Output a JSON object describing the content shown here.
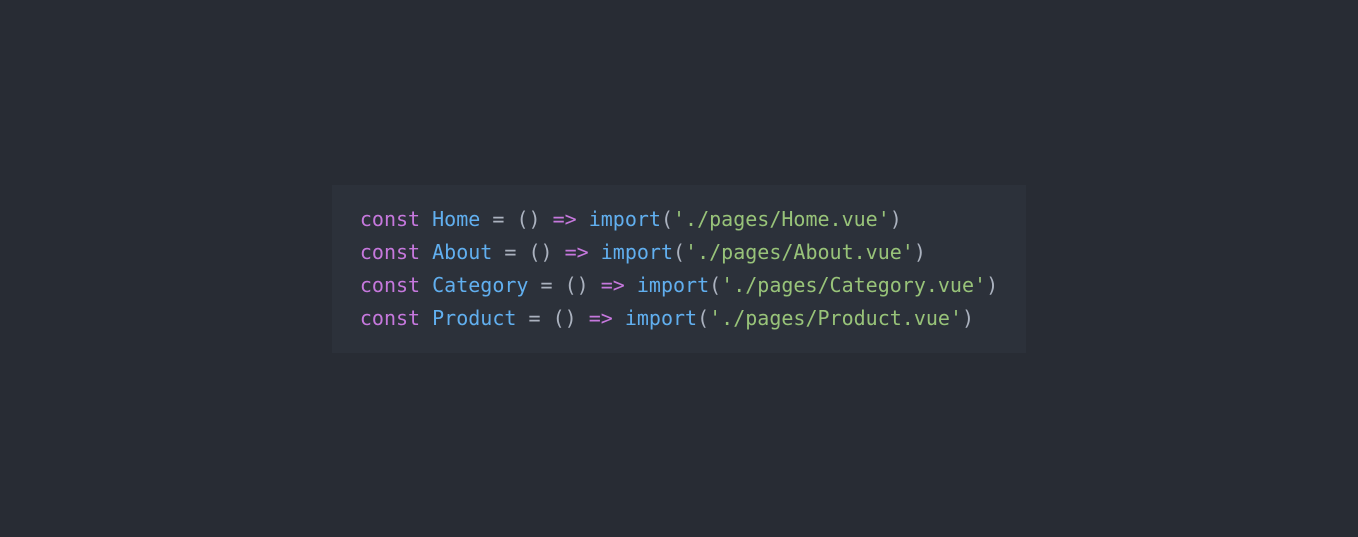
{
  "code": {
    "lines": [
      {
        "keyword": "const",
        "variable": "Home",
        "equals": " = ",
        "parens1": "()",
        "arrow": " => ",
        "func": "import",
        "paren_open": "(",
        "string": "'./pages/Home.vue'",
        "paren_close": ")"
      },
      {
        "keyword": "const",
        "variable": "About",
        "equals": " = ",
        "parens1": "()",
        "arrow": " => ",
        "func": "import",
        "paren_open": "(",
        "string": "'./pages/About.vue'",
        "paren_close": ")"
      },
      {
        "keyword": "const",
        "variable": "Category",
        "equals": " = ",
        "parens1": "()",
        "arrow": " => ",
        "func": "import",
        "paren_open": "(",
        "string": "'./pages/Category.vue'",
        "paren_close": ")"
      },
      {
        "keyword": "const",
        "variable": "Product",
        "equals": " = ",
        "parens1": "()",
        "arrow": " => ",
        "func": "import",
        "paren_open": "(",
        "string": "'./pages/Product.vue'",
        "paren_close": ")"
      }
    ]
  }
}
